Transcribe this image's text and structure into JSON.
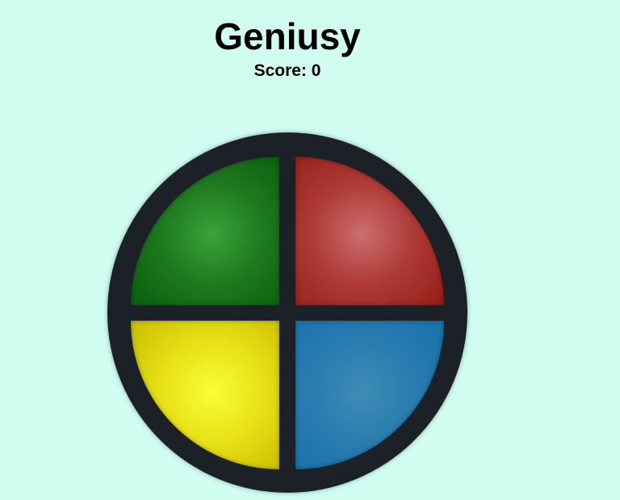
{
  "game": {
    "title": "Geniusy",
    "score_label": "Score: 0",
    "score": 0
  },
  "board": {
    "pads": [
      {
        "name": "green",
        "color": "#1e7a1e"
      },
      {
        "name": "red",
        "color": "#ae3b36"
      },
      {
        "name": "yellow",
        "color": "#e7e116"
      },
      {
        "name": "blue",
        "color": "#2a7cb0"
      }
    ],
    "frame_color": "#1b2126"
  },
  "colors": {
    "background": "#d0fdf0",
    "text": "#000000"
  }
}
